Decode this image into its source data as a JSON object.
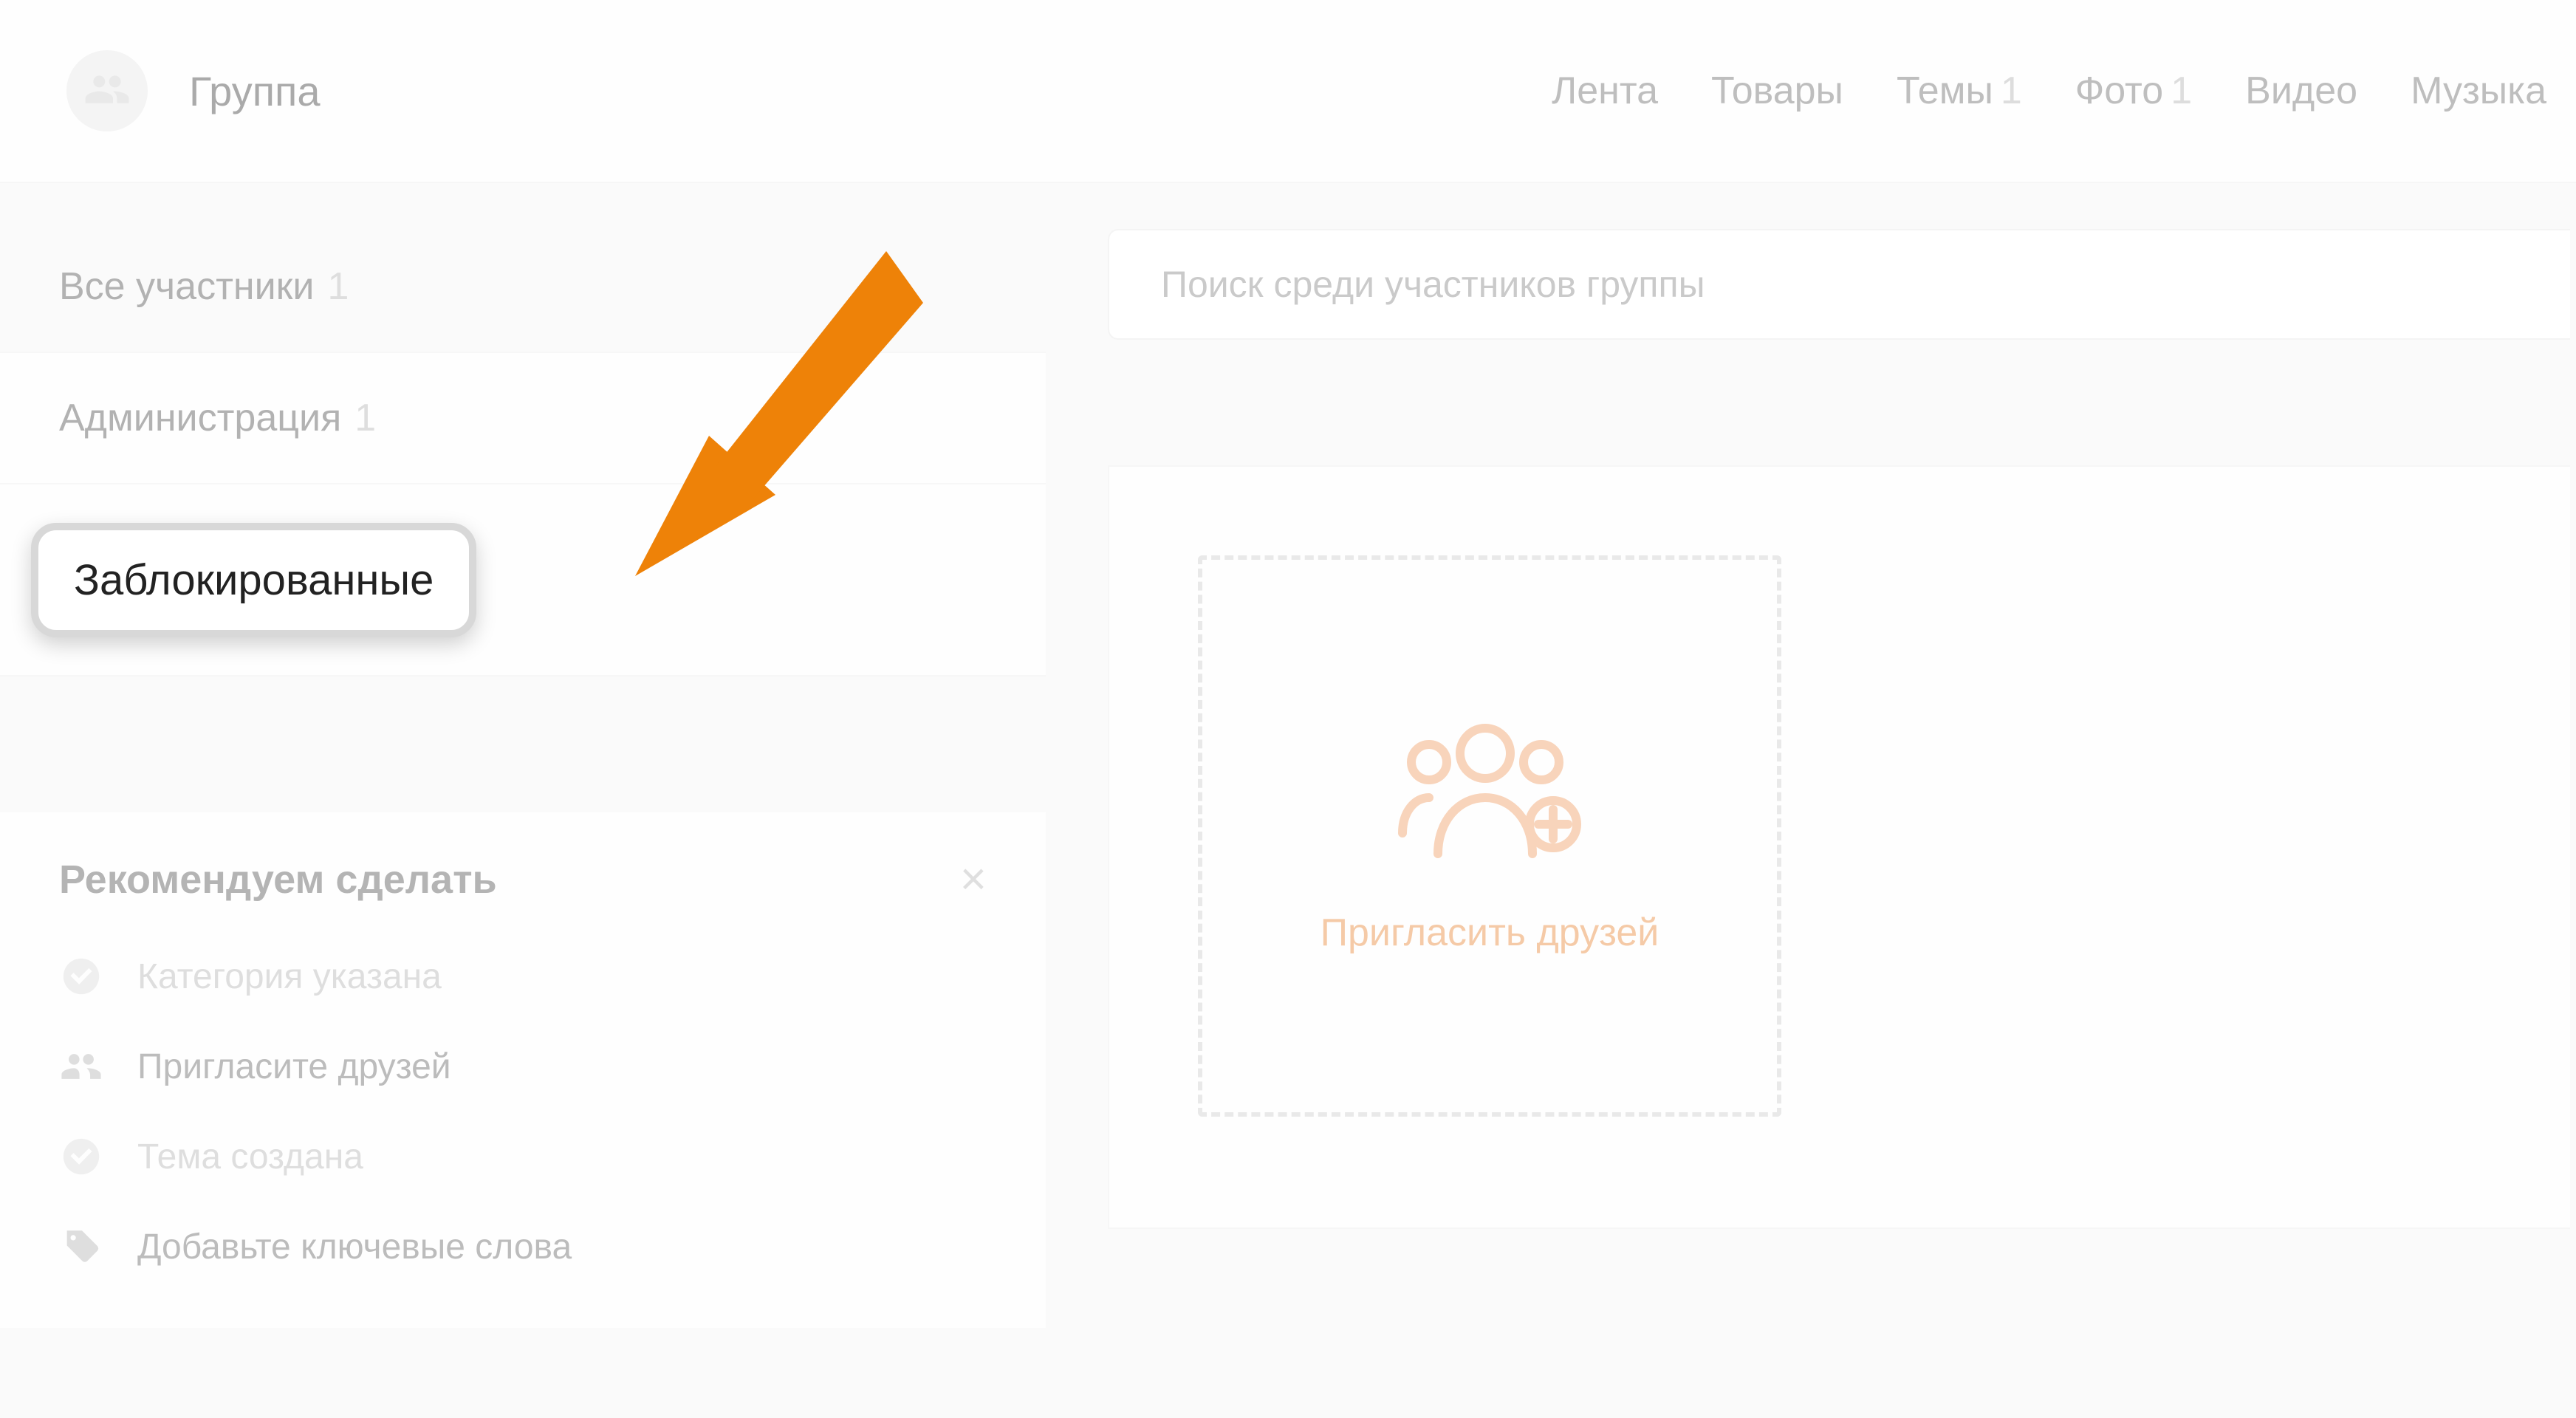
{
  "header": {
    "title": "Группа",
    "nav": [
      {
        "label": "Лента",
        "count": ""
      },
      {
        "label": "Товары",
        "count": ""
      },
      {
        "label": "Темы",
        "count": "1"
      },
      {
        "label": "Фото",
        "count": "1"
      },
      {
        "label": "Видео",
        "count": ""
      },
      {
        "label": "Музыка",
        "count": ""
      }
    ]
  },
  "sidebar": {
    "items": [
      {
        "label": "Все участники",
        "count": "1"
      },
      {
        "label": "Администрация",
        "count": "1"
      },
      {
        "label": "Заблокированные",
        "count": ""
      }
    ]
  },
  "reco": {
    "title": "Рекомендуем сделать",
    "items": [
      {
        "label": "Категория указана",
        "state": "done",
        "icon": "check"
      },
      {
        "label": "Пригласите друзей",
        "state": "todo",
        "icon": "people"
      },
      {
        "label": "Тема создана",
        "state": "done",
        "icon": "check"
      },
      {
        "label": "Добавьте ключевые слова",
        "state": "todo",
        "icon": "tag"
      }
    ]
  },
  "search": {
    "placeholder": "Поиск среди участников группы"
  },
  "invite": {
    "label": "Пригласить друзей"
  },
  "colors": {
    "accent": "#ee8208"
  }
}
